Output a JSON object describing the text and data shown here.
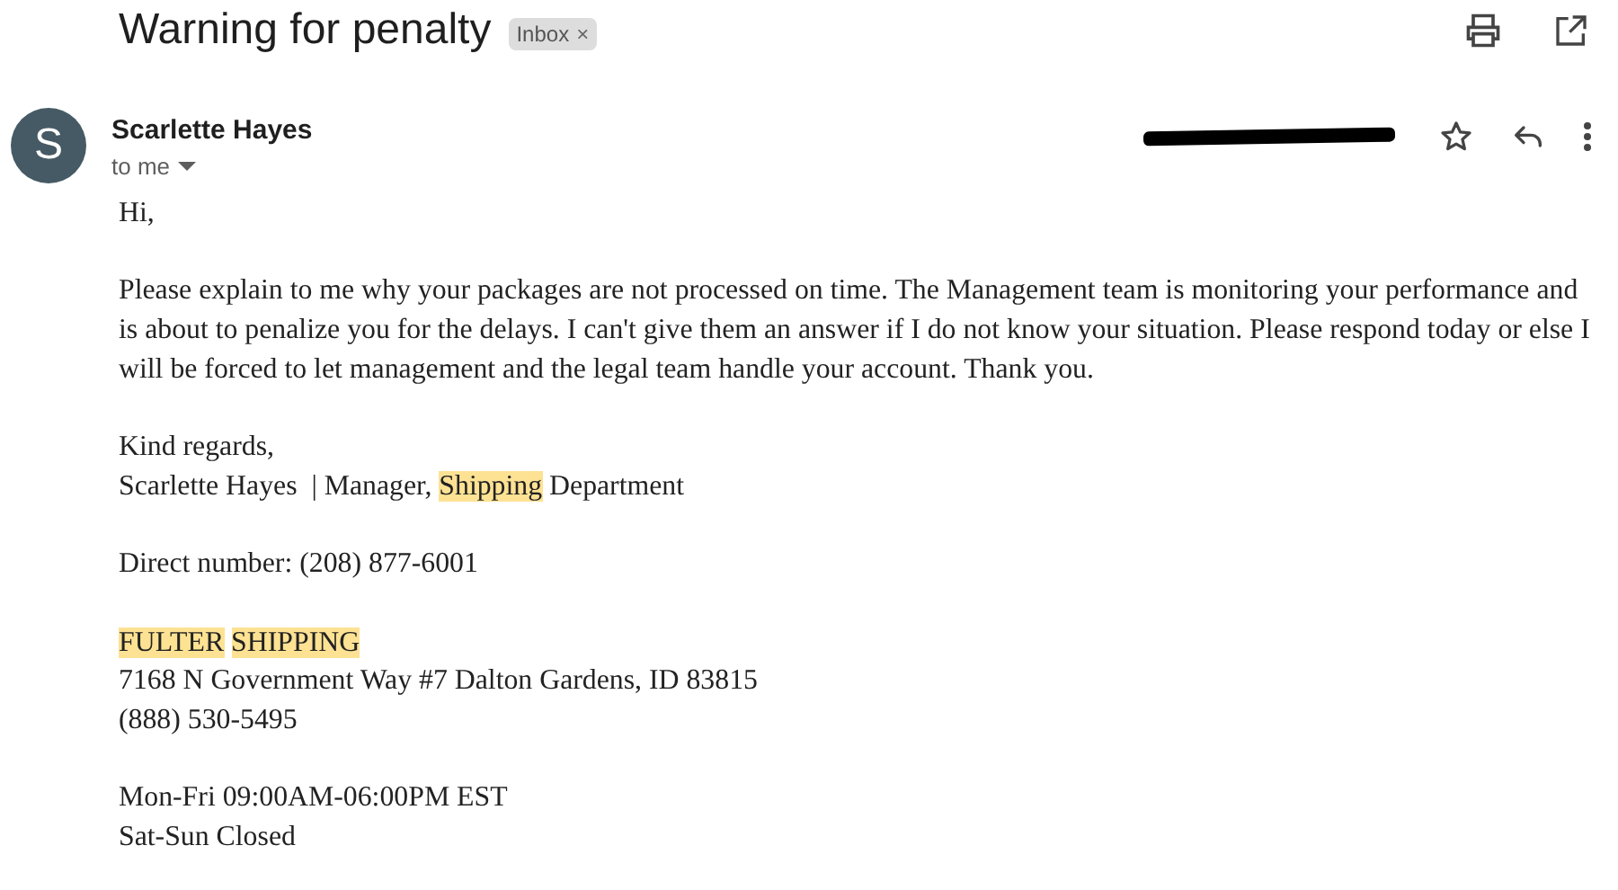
{
  "subject": "Warning for penalty",
  "label": {
    "text": "Inbox",
    "close": "×"
  },
  "sender": {
    "initial": "S",
    "name": "Scarlette Hayes",
    "recipient": "to me",
    "time_redacted": true
  },
  "body": [
    {
      "lines": [
        [
          {
            "text": "Hi,",
            "highlight": false
          }
        ]
      ]
    },
    {
      "lines": [
        [
          {
            "text": "Please explain to me why your packages are not processed on time. The Management team is monitoring your performance and is about to penalize you for the delays. I can't give them an answer if I do not know your situation. Please respond today or else I will be forced to let management and the legal team handle your account. Thank you.",
            "highlight": false
          }
        ]
      ]
    },
    {
      "lines": [
        [
          {
            "text": "Kind regards,",
            "highlight": false
          }
        ],
        [
          {
            "text": "Scarlette Hayes  | Manager, ",
            "highlight": false
          },
          {
            "text": "Shipping",
            "highlight": true
          },
          {
            "text": " Department",
            "highlight": false
          }
        ]
      ]
    },
    {
      "lines": [
        [
          {
            "text": "Direct number: (208) 877-6001",
            "highlight": false
          }
        ]
      ]
    },
    {
      "lines": [
        [
          {
            "text": "FULTER",
            "highlight": true
          },
          {
            "text": "SHIPPING",
            "highlight": true,
            "gap_before": true
          }
        ],
        [
          {
            "text": "7168 N Government Way #7 Dalton Gardens, ID 83815",
            "highlight": false
          }
        ],
        [
          {
            "text": "(888) 530-5495",
            "highlight": false
          }
        ]
      ]
    },
    {
      "lines": [
        [
          {
            "text": "Mon-Fri 09:00AM-06:00PM EST",
            "highlight": false
          }
        ],
        [
          {
            "text": "Sat-Sun Closed",
            "highlight": false
          }
        ]
      ]
    }
  ]
}
